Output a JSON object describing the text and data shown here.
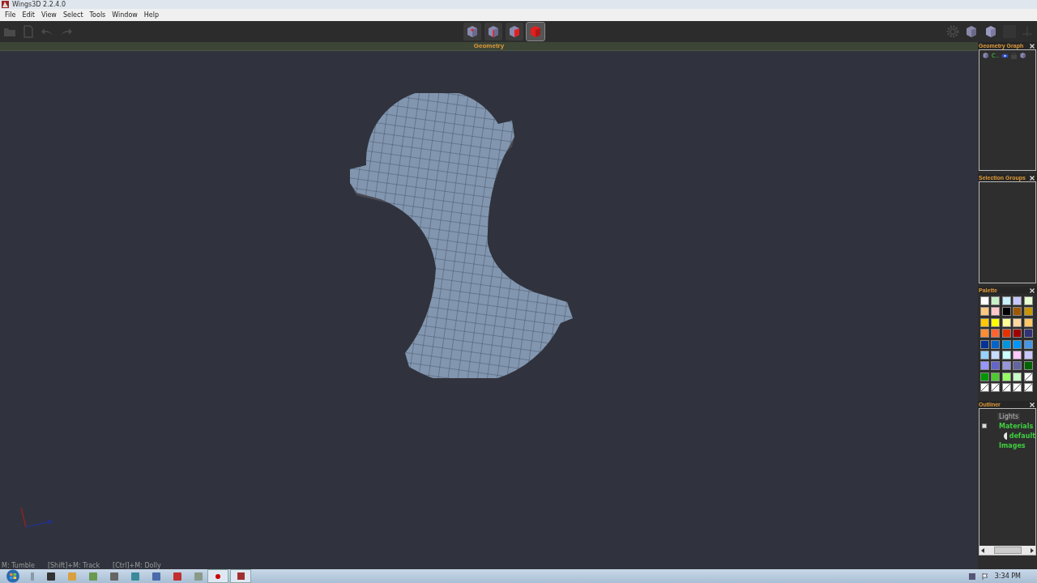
{
  "window": {
    "title": "Wings3D 2.2.4.0"
  },
  "menu": [
    "File",
    "Edit",
    "View",
    "Select",
    "Tools",
    "Window",
    "Help"
  ],
  "select_modes": [
    {
      "kind": "vertex",
      "selected": false
    },
    {
      "kind": "edge",
      "selected": false
    },
    {
      "kind": "face",
      "selected": false
    },
    {
      "kind": "body",
      "selected": true
    }
  ],
  "viewport": {
    "title": "Geometry",
    "status": [
      "M: Tumble",
      "[Shift]+M: Track",
      "[Ctrl]+M: Dolly"
    ]
  },
  "geometry_graph": {
    "title": "Geometry Graph",
    "objects": [
      {
        "name": "C.."
      }
    ]
  },
  "selection_groups": {
    "title": "Selection Groups"
  },
  "palette": {
    "title": "Palette",
    "swatches": [
      {
        "kind": "swatch",
        "color": "#ffffff"
      },
      {
        "kind": "swatch",
        "color": "#c8f0c8"
      },
      {
        "kind": "swatch",
        "color": "#c8f0ff"
      },
      {
        "kind": "swatch",
        "color": "#c8c8ff"
      },
      {
        "kind": "swatch",
        "color": "#e8ffd0"
      },
      {
        "kind": "swatch",
        "color": "#ffc880"
      },
      {
        "kind": "swatch",
        "color": "#ffc8c8"
      },
      {
        "kind": "swatch",
        "color": "#000000"
      },
      {
        "kind": "swatch",
        "color": "#a05800"
      },
      {
        "kind": "swatch",
        "color": "#c89600"
      },
      {
        "kind": "swatch",
        "color": "#ffc800"
      },
      {
        "kind": "swatch",
        "color": "#ffff00"
      },
      {
        "kind": "swatch",
        "color": "#ffff96"
      },
      {
        "kind": "swatch",
        "color": "#ffd7a0"
      },
      {
        "kind": "swatch",
        "color": "#ffc864"
      },
      {
        "kind": "swatch",
        "color": "#ff8c32"
      },
      {
        "kind": "swatch",
        "color": "#ff6432"
      },
      {
        "kind": "swatch",
        "color": "#e63200"
      },
      {
        "kind": "swatch",
        "color": "#a00000"
      },
      {
        "kind": "swatch",
        "color": "#323278"
      },
      {
        "kind": "swatch",
        "color": "#003296"
      },
      {
        "kind": "swatch",
        "color": "#0064c8"
      },
      {
        "kind": "swatch",
        "color": "#0096dc"
      },
      {
        "kind": "swatch",
        "color": "#0096ff"
      },
      {
        "kind": "swatch",
        "color": "#4696e6"
      },
      {
        "kind": "swatch",
        "color": "#96d2ff"
      },
      {
        "kind": "swatch",
        "color": "#c8dcff"
      },
      {
        "kind": "swatch",
        "color": "#c8ffff"
      },
      {
        "kind": "swatch",
        "color": "#ffc8ff"
      },
      {
        "kind": "swatch",
        "color": "#c8c8ff"
      },
      {
        "kind": "swatch",
        "color": "#9696ff"
      },
      {
        "kind": "swatch",
        "color": "#6464c8"
      },
      {
        "kind": "swatch",
        "color": "#9696dc"
      },
      {
        "kind": "swatch",
        "color": "#6464a0"
      },
      {
        "kind": "swatch",
        "color": "#006400"
      },
      {
        "kind": "swatch",
        "color": "#009600"
      },
      {
        "kind": "swatch",
        "color": "#50c832"
      },
      {
        "kind": "swatch",
        "color": "#96ff64"
      },
      {
        "kind": "swatch",
        "color": "#c8ffc8"
      },
      {
        "kind": "empty"
      },
      {
        "kind": "empty"
      },
      {
        "kind": "empty"
      },
      {
        "kind": "empty"
      },
      {
        "kind": "empty"
      },
      {
        "kind": "empty"
      }
    ]
  },
  "outliner": {
    "title": "Outliner",
    "items": [
      {
        "label": "Lights",
        "kind": "lights"
      },
      {
        "label": "Materials",
        "kind": "folder",
        "children": [
          {
            "label": "default",
            "kind": "material"
          }
        ]
      },
      {
        "label": "Images",
        "kind": "folder"
      }
    ]
  },
  "taskbar": {
    "clock": "3:34 PM"
  }
}
